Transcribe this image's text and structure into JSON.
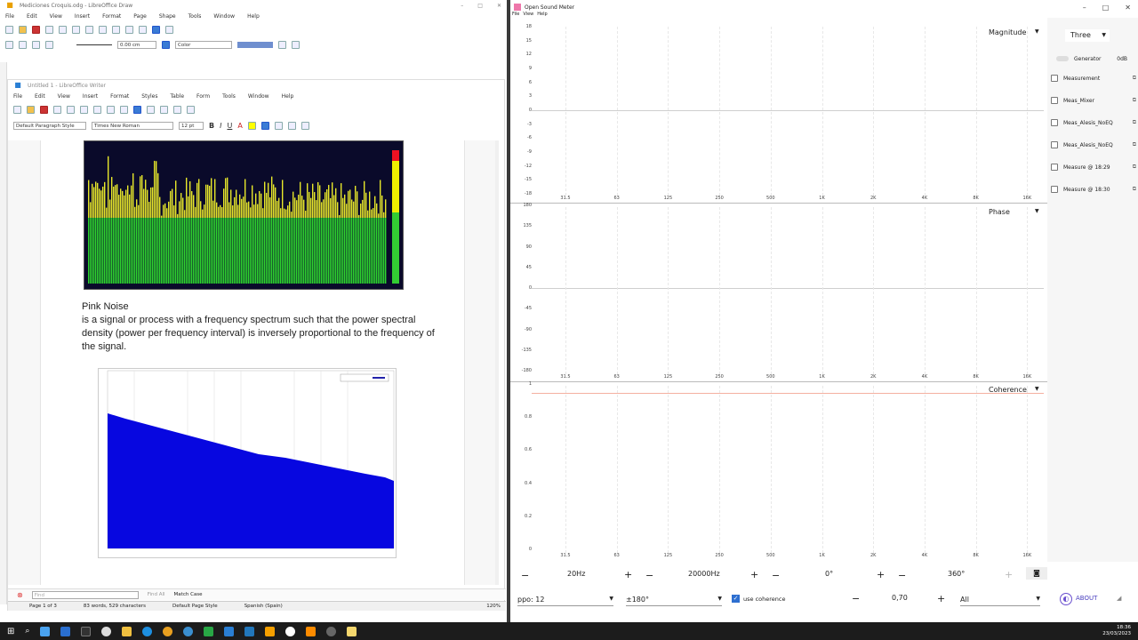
{
  "draw": {
    "title": "Mediciones Croquis.odg - LibreOffice Draw",
    "menu": [
      "File",
      "Edit",
      "View",
      "Insert",
      "Format",
      "Page",
      "Shape",
      "Tools",
      "Window",
      "Help"
    ],
    "line_width": "0.00 cm",
    "fill_label": "Color"
  },
  "writer": {
    "title": "Untitled 1 - LibreOffice Writer",
    "menu": [
      "File",
      "Edit",
      "View",
      "Insert",
      "Format",
      "Styles",
      "Table",
      "Form",
      "Tools",
      "Window",
      "Help"
    ],
    "para_style": "Default Paragraph Style",
    "font_name": "Times New Roman",
    "font_size": "12 pt",
    "body_heading": "Pink Noise",
    "body_text": "is a signal or process with a frequency spectrum such that the power spectral density (power per frequency interval) is inversely proportional to the frequency of the signal.",
    "find_placeholder": "Find",
    "find_all": "Find All",
    "match_case": "Match Case",
    "status_page": "Page 1 of 3",
    "status_words": "83 words, 529 characters",
    "status_style": "Default Page Style",
    "status_lang": "Spanish (Spain)",
    "zoom": "120%"
  },
  "osm": {
    "title": "Open Sound Meter",
    "menu": [
      "File",
      "View",
      "Help"
    ],
    "magnitude": {
      "title": "Magnitude",
      "yticks": [
        "18",
        "15",
        "12",
        "9",
        "6",
        "3",
        "0",
        "-3",
        "-6",
        "-9",
        "-12",
        "-15",
        "-18"
      ]
    },
    "phase": {
      "title": "Phase",
      "yticks": [
        "180",
        "135",
        "90",
        "45",
        "0",
        "-45",
        "-90",
        "-135",
        "-180"
      ]
    },
    "coherence": {
      "title": "Coherence",
      "yticks": [
        "1",
        "0.8",
        "0.6",
        "0.4",
        "0.2",
        "0"
      ]
    },
    "xticks": [
      "31.5",
      "63",
      "125",
      "250",
      "500",
      "1K",
      "2K",
      "4K",
      "8K",
      "16K"
    ],
    "right_panel": {
      "mode": "Three",
      "generator": "Generator",
      "generator_level": "0dB",
      "measurements": [
        "Measurement",
        "Meas_Mixer",
        "Meas_Alesis_NoEQ",
        "Meas_Alesis_NoEQ",
        "Measure @ 18:29",
        "Measure @ 18:30"
      ]
    },
    "controls": {
      "fmin": "20Hz",
      "fmax": "20000Hz",
      "phase_min": "0°",
      "phase_max": "360°",
      "ppo": "ppo: 12",
      "phase_range": "±180°",
      "use_coherence": "use coherence",
      "coh_threshold": "0,70",
      "filter": "All",
      "about": "ABOUT"
    }
  },
  "taskbar": {
    "time": "18:36",
    "date": "23/03/2023"
  }
}
